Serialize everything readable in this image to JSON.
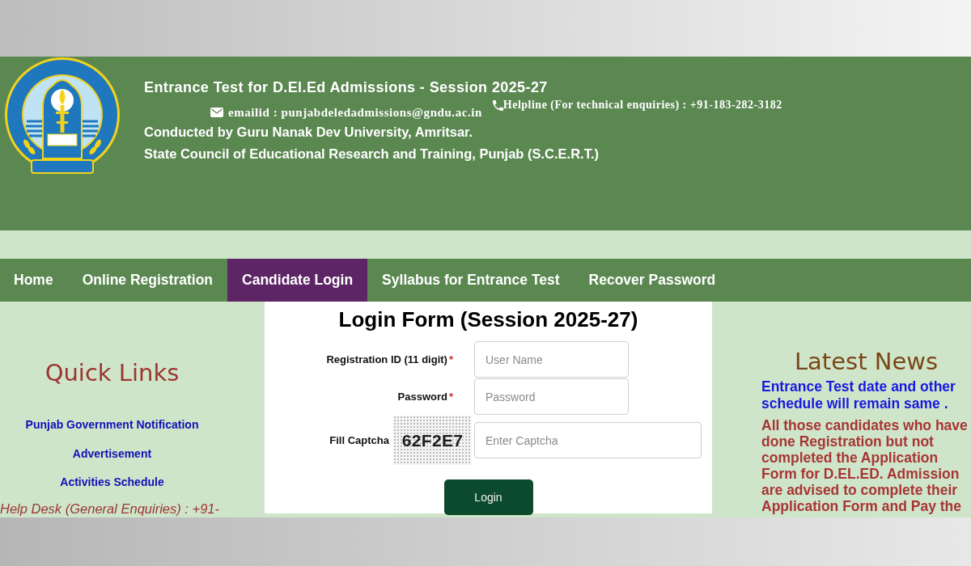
{
  "header": {
    "title": "Entrance Test for D.El.Ed Admissions - Session 2025-27",
    "email": "emailid : punjabdeledadmissions@gndu.ac.in",
    "helpline": "Helpline (For technical enquiries) : +91-183-282-3182",
    "lines": [
      "Conducted by Guru Nanak Dev University, Amritsar.",
      "State Council of Educational Research and Training, Punjab (S.C.E.R.T.)"
    ]
  },
  "nav": [
    {
      "label": "Home",
      "selected": false
    },
    {
      "label": "Online Registration",
      "selected": false
    },
    {
      "label": "Candidate Login",
      "selected": true
    },
    {
      "label": "Syllabus for Entrance Test",
      "selected": false
    },
    {
      "label": "Recover Password",
      "selected": false
    }
  ],
  "quick_links": {
    "title": "Quick Links",
    "links": [
      "Punjab Government Notification",
      "Advertisement",
      "Activities Schedule"
    ],
    "help_desk": "Help Desk (General Enquiries) : +91-"
  },
  "login_form": {
    "title": "Login Form (Session 2025-27)",
    "fields": [
      {
        "kind": "text",
        "label": "Registration ID (11 digit)",
        "required_mark": "*",
        "placeholder": "User Name"
      },
      {
        "kind": "password",
        "label": "Password",
        "required_mark": "*",
        "placeholder": "Password"
      },
      {
        "kind": "captcha",
        "label": "Fill Captcha",
        "captcha": "62F2E7",
        "placeholder": "Enter Captcha"
      }
    ],
    "button": "Login"
  },
  "latest_news": {
    "title": "Latest News",
    "items": [
      {
        "text": "Entrance Test date and other schedule will remain same .",
        "color": "#1818e0"
      },
      {
        "text": "All those candidates who have done Registration but not completed the Application Form for D.EL.ED. Admission are advised to complete their Application Form and Pay the",
        "color": "#a83535"
      }
    ]
  }
}
